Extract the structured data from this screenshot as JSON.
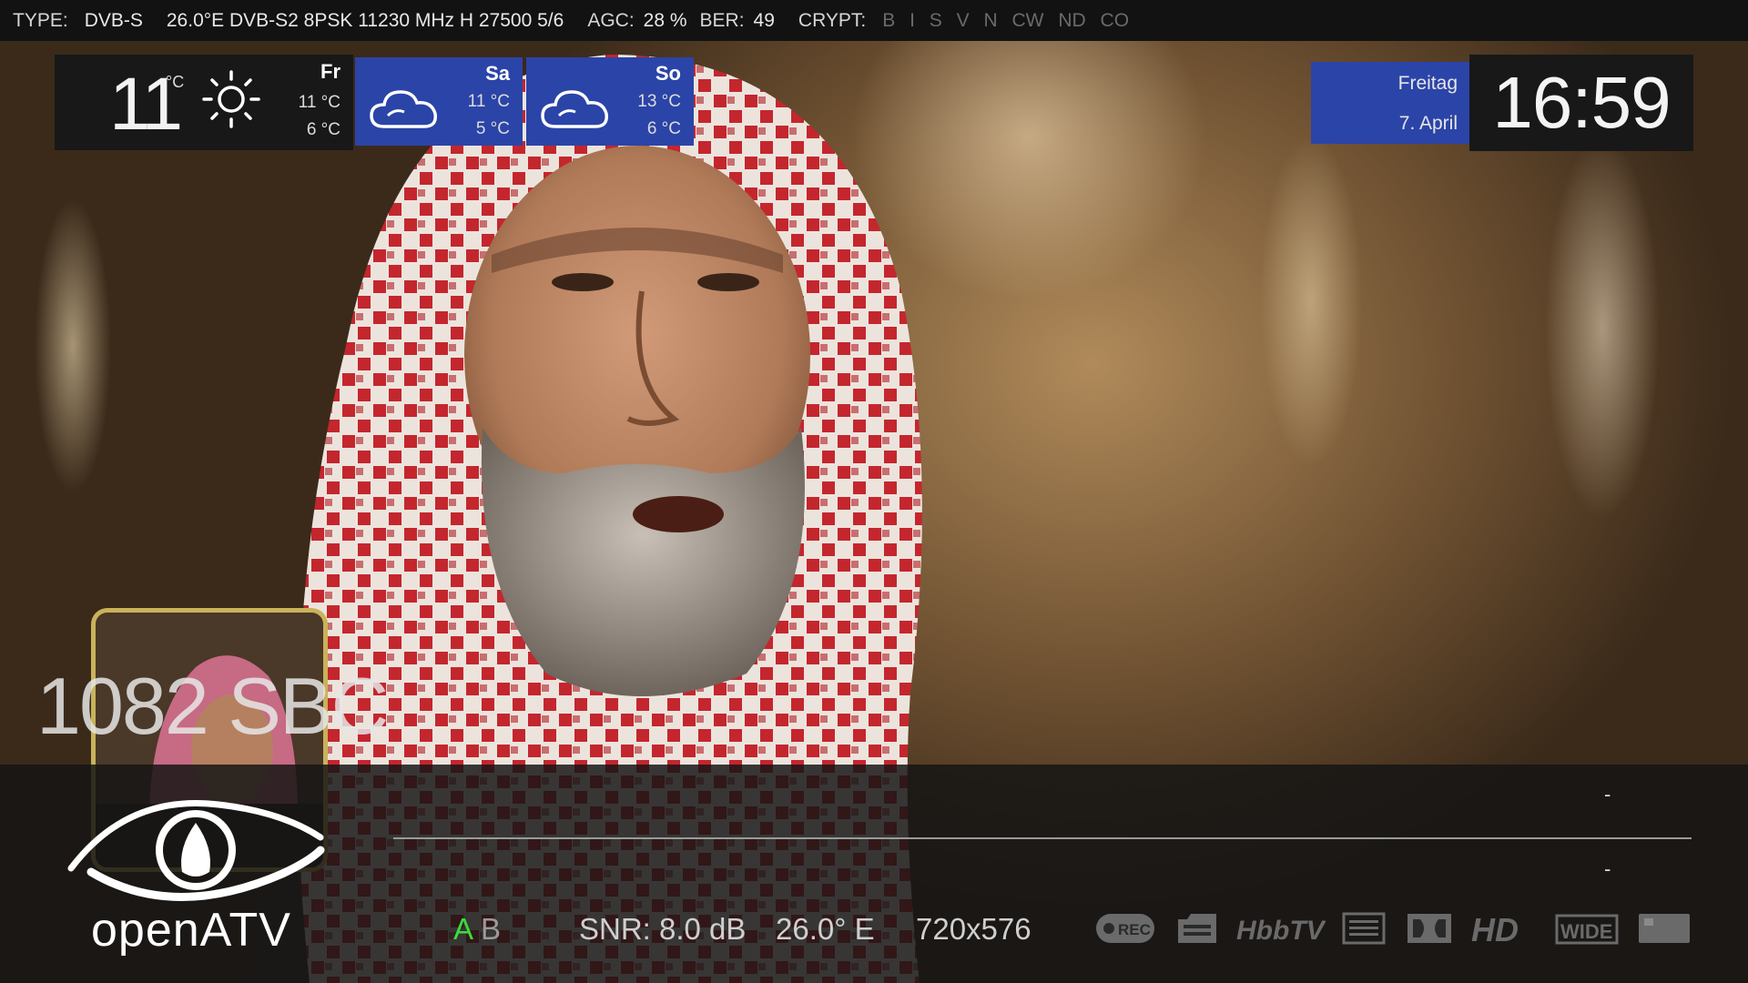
{
  "topbar": {
    "type_label": "TYPE:",
    "type_value": "DVB-S",
    "transponder": "26.0°E DVB-S2 8PSK 11230 MHz H 27500 5/6",
    "agc_label": "AGC:",
    "agc_value": "28 %",
    "ber_label": "BER:",
    "ber_value": "49",
    "crypt_label": "CRYPT:",
    "crypt_systems": [
      "B",
      "I",
      "S",
      "V",
      "N",
      "CW",
      "ND",
      "CO"
    ]
  },
  "weather": {
    "current": {
      "temp": "11",
      "unit": "°C",
      "icon": "sun-icon",
      "day": "Fr",
      "high": "11 °C",
      "low": "6 °C"
    },
    "forecast": [
      {
        "day": "Sa",
        "icon": "cloud-icon",
        "high": "11 °C",
        "low": "5 °C"
      },
      {
        "day": "So",
        "icon": "cloud-icon",
        "high": "13 °C",
        "low": "6 °C"
      }
    ]
  },
  "datetime": {
    "weekday": "Freitag",
    "date": "7. April",
    "time": "16:59"
  },
  "channel": {
    "name": "1082 SBC"
  },
  "infobar": {
    "now_dash": "-",
    "next_dash": "-",
    "logo_text": "openATV",
    "tuner_active": "A",
    "tuner_inactive": "B",
    "snr": "SNR: 8.0 dB",
    "orbital": "26.0° E",
    "resolution": "720x576",
    "status_icons": [
      "rec-icon",
      "subtitle-icon",
      "hbbtv-icon",
      "teletext-icon",
      "dolby-icon",
      "hd-icon",
      "widescreen-icon",
      "crypt-card-icon"
    ]
  },
  "colors": {
    "accent_blue": "#2b44a8",
    "tuner_active": "#3cdc3c",
    "picon_border": "#c9b25a"
  }
}
